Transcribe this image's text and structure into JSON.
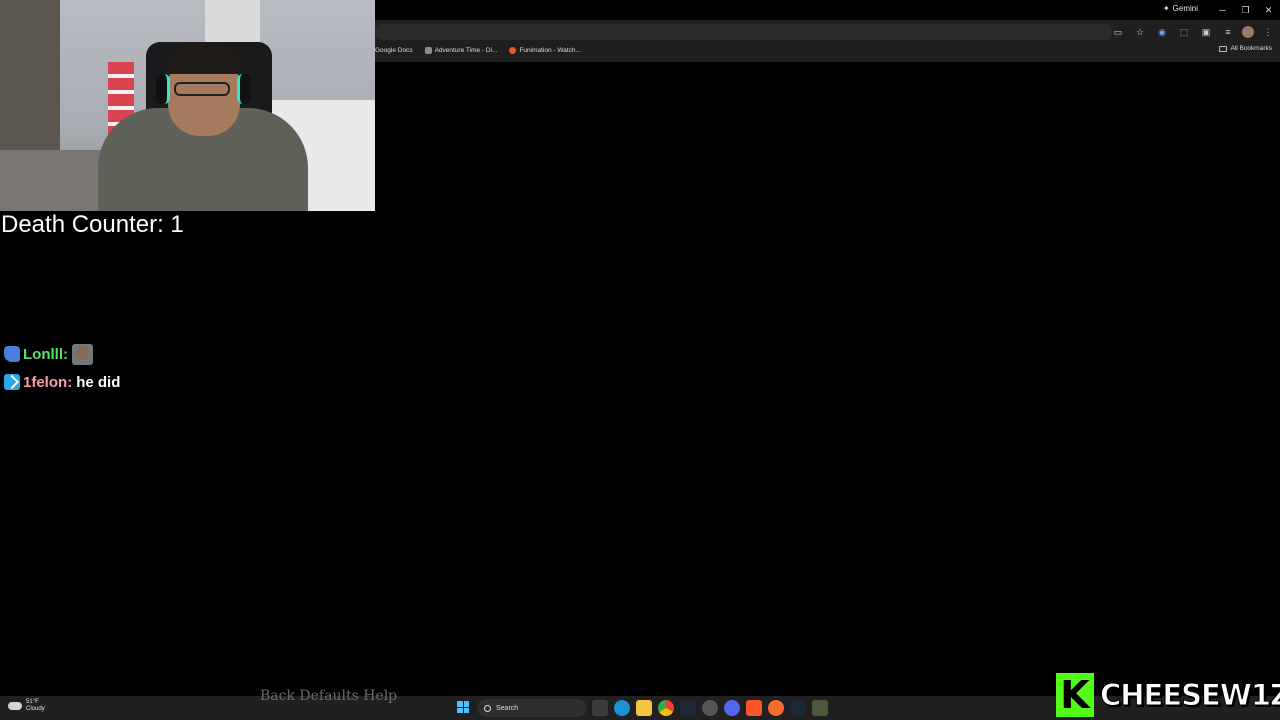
{
  "browser": {
    "gemini_label": "Gemini",
    "bookmarks": [
      {
        "label": "Google Docs",
        "color": "#4285f4"
      },
      {
        "label": "Adventure Time - Di...",
        "color": "#9a9a9a"
      },
      {
        "label": "Funimation - Watch...",
        "color": "#e8562c"
      }
    ],
    "all_bookmarks_label": "All Bookmarks"
  },
  "overlay": {
    "death_counter": "Death Counter: 1",
    "chat": [
      {
        "user": "Lonlll",
        "text": "",
        "user_color": "#5be06a",
        "badge": "thumb-icon",
        "emote": true
      },
      {
        "user": "1felon",
        "text": "he did",
        "user_color": "#ff9aa8",
        "badge": "prime-icon",
        "emote": false
      }
    ]
  },
  "taskbar": {
    "weather_temp": "51°F",
    "weather_desc": "Cloudy",
    "game_hint": "Back  Defaults  Help",
    "search_placeholder": "Search",
    "apps": [
      "files-icon",
      "edge-icon",
      "explorer-icon",
      "chrome-icon",
      "steam-icon",
      "app-icon",
      "discord-icon",
      "brave-icon",
      "origin-icon",
      "steam-icon",
      "game-icon"
    ]
  },
  "logo": {
    "k_letter": "K",
    "channel_name": "CHEESEW1Z",
    "accent": "#53fc18"
  }
}
